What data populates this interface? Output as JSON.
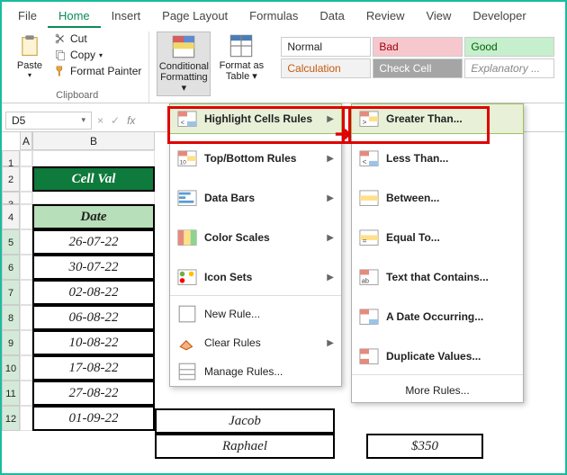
{
  "tabs": [
    "File",
    "Home",
    "Insert",
    "Page Layout",
    "Formulas",
    "Data",
    "Review",
    "View",
    "Developer"
  ],
  "active_tab": "Home",
  "clipboard": {
    "paste": "Paste",
    "cut": "Cut",
    "copy": "Copy",
    "format_painter": "Format Painter",
    "group": "Clipboard"
  },
  "cf": {
    "label": "Conditional\nFormatting"
  },
  "fat": {
    "label": "Format as\nTable"
  },
  "styles": {
    "normal": "Normal",
    "bad": "Bad",
    "good": "Good",
    "calc": "Calculation",
    "check": "Check Cell",
    "expl": "Explanatory ..."
  },
  "namebox": "D5",
  "menu1": {
    "highlight": "Highlight Cells Rules",
    "topbottom": "Top/Bottom Rules",
    "databars": "Data Bars",
    "colorscales": "Color Scales",
    "iconsets": "Icon Sets",
    "newrule": "New Rule...",
    "clear": "Clear Rules",
    "manage": "Manage Rules..."
  },
  "menu2": {
    "greater": "Greater Than...",
    "less": "Less Than...",
    "between": "Between...",
    "equal": "Equal To...",
    "text": "Text that Contains...",
    "date": "A Date Occurring...",
    "dup": "Duplicate Values...",
    "more": "More Rules..."
  },
  "sheet": {
    "colA": "A",
    "colB": "B",
    "title": "Cell Val",
    "date_hdr": "Date",
    "rows": [
      "26-07-22",
      "30-07-22",
      "02-08-22",
      "06-08-22",
      "10-08-22",
      "17-08-22",
      "27-08-22",
      "01-09-22"
    ],
    "name11": "Jacob",
    "name12": "Raphael",
    "amount12": "$350"
  }
}
